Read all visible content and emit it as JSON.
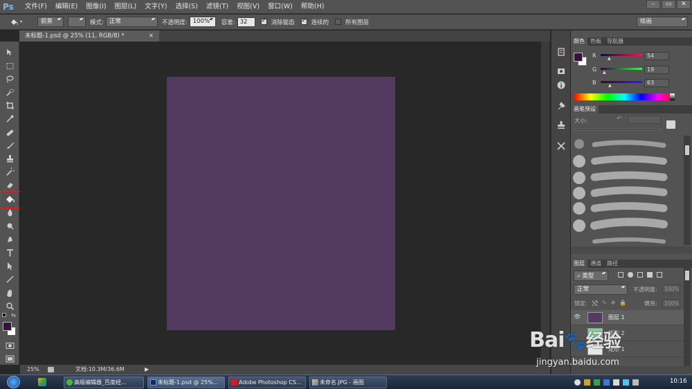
{
  "app": {
    "logo": "Ps"
  },
  "menu": [
    "文件(F)",
    "编辑(E)",
    "图像(I)",
    "图层(L)",
    "文字(Y)",
    "选择(S)",
    "滤镜(T)",
    "视图(V)",
    "窗口(W)",
    "帮助(H)"
  ],
  "window_buttons": [
    "–",
    "▭",
    "✕"
  ],
  "options": {
    "fill_source": "前景",
    "mode_label": "模式:",
    "mode_value": "正常",
    "opacity_label": "不透明度:",
    "opacity_value": "100%",
    "tolerance_label": "容差:",
    "tolerance_value": "32",
    "antialias_label": "消除锯齿",
    "contiguous_label": "连续的",
    "all_layers_label": "所有图层",
    "workspace": "绘画"
  },
  "document": {
    "tab_title": "未标题-1.psd @ 25% (11, RGB/8) *",
    "tab_close": "×",
    "zoom": "25%",
    "doc_size": "文档:10.3M/36.6M",
    "fill_color": "#533a5f"
  },
  "colors": {
    "foreground": "#36133f",
    "background": "#ffffff",
    "accent_box": "#e02020"
  },
  "color_panel": {
    "tabs": [
      "颜色",
      "色板",
      "导航器"
    ],
    "r_label": "R",
    "r_value": "54",
    "g_label": "G",
    "g_value": "19",
    "b_label": "B",
    "b_value": "63"
  },
  "brush_panel": {
    "tabs": [
      "画笔预设"
    ],
    "size_label": "大小:"
  },
  "layers_panel": {
    "tabs": [
      "图层",
      "通道",
      "路径"
    ],
    "filter_kind": "类型",
    "blend_mode": "正常",
    "opacity_label": "不透明度:",
    "opacity_value": "100%",
    "lock_label": "锁定:",
    "fill_label": "填充:",
    "fill_value": "100%",
    "layers": [
      "图层 1",
      "矩形 2",
      "矩形 1"
    ]
  },
  "taskbar": {
    "items": [
      "高级编辑器_百度经...",
      "未标题-1.psd @ 25%...",
      "Adobe Photoshop CS...",
      "未命名.JPG - 画图"
    ],
    "clock": "10:16"
  },
  "watermark": {
    "brand": "Bai",
    "brand2": "经验",
    "url": "jingyan.baidu.com"
  }
}
